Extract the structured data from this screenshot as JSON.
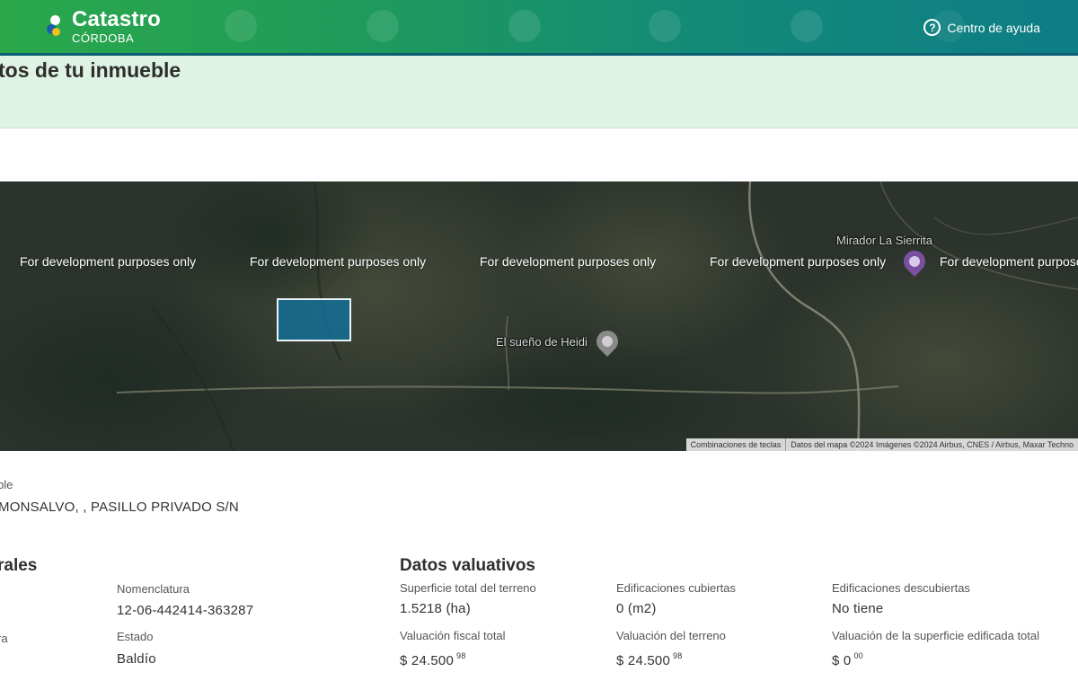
{
  "header": {
    "brand_title": "Catastro",
    "brand_sub": "CÓRDOBA",
    "help_label": "Centro de ayuda",
    "colors": {
      "primary_green": "#2aa84a",
      "teal": "#0e7d86"
    }
  },
  "page": {
    "title": "tos de tu inmueble"
  },
  "map": {
    "watermark": "For development purposes only",
    "places": [
      "Mirador La Sierrita",
      "El sueño de Heidi"
    ],
    "attribution": [
      "Combinaciones de teclas",
      "Datos del mapa ©2024 Imágenes ©2024 Airbus, CNES / Airbus, Maxar Techno"
    ],
    "parcel_color": "#146e96"
  },
  "address": {
    "label": "ble",
    "value": "MONSALVO, , PASILLO PRIVADO S/N"
  },
  "general": {
    "title": "rales",
    "side_label": "ra",
    "nomenclatura_label": "Nomenclatura",
    "nomenclatura_value": "12-06-442414-363287",
    "estado_label": "Estado",
    "estado_value": "Baldío"
  },
  "valuation": {
    "title": "Datos valuativos",
    "items": [
      {
        "label": "Superficie total del terreno",
        "value": "1.5218 (ha)"
      },
      {
        "label": "Edificaciones cubiertas",
        "value": "0 (m2)"
      },
      {
        "label": "Edificaciones descubiertas",
        "value": "No tiene"
      },
      {
        "label": "Valuación fiscal total",
        "value": "$ 24.500",
        "cents": "98"
      },
      {
        "label": "Valuación del terreno",
        "value": "$ 24.500",
        "cents": "98"
      },
      {
        "label": "Valuación de la superficie edificada total",
        "value": "$ 0",
        "cents": "00"
      }
    ]
  }
}
